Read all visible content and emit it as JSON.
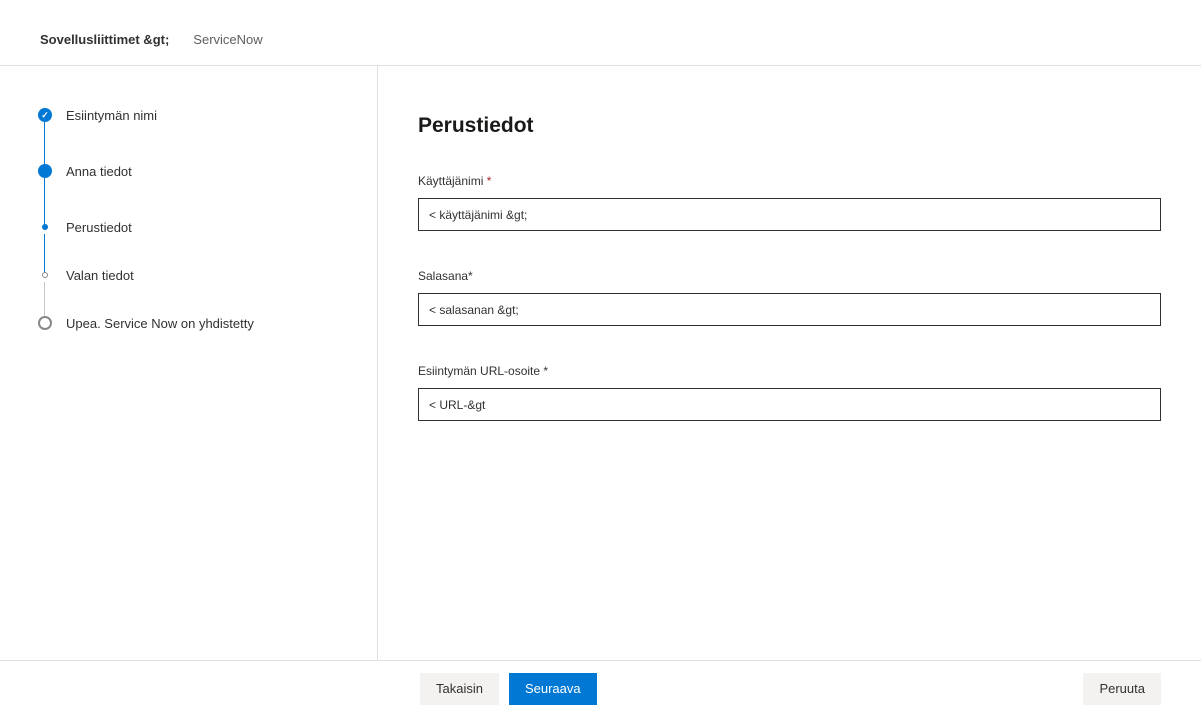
{
  "breadcrumb": {
    "root": "Sovellusliittimet &gt;",
    "current": "ServiceNow"
  },
  "steps": [
    {
      "label": "Esiintymän nimi",
      "state": "done"
    },
    {
      "label": "Anna tiedot",
      "state": "active"
    },
    {
      "label": "Perustiedot",
      "state": "sub"
    },
    {
      "label": "Valan tiedot",
      "state": "sub-future"
    },
    {
      "label": "Upea. Service Now on yhdistetty",
      "state": "last"
    }
  ],
  "page": {
    "title": "Perustiedot"
  },
  "form": {
    "username": {
      "label": "Käyttäjänimi",
      "required": "*",
      "value": "< käyttäjänimi &gt;"
    },
    "password": {
      "label": "Salasana*",
      "value": "< salasanan &gt;"
    },
    "instanceUrl": {
      "label": "Esiintymän URL-osoite *",
      "value": "< URL-&gt"
    }
  },
  "footer": {
    "back": "Takaisin",
    "next": "Seuraava",
    "cancel": "Peruuta"
  }
}
